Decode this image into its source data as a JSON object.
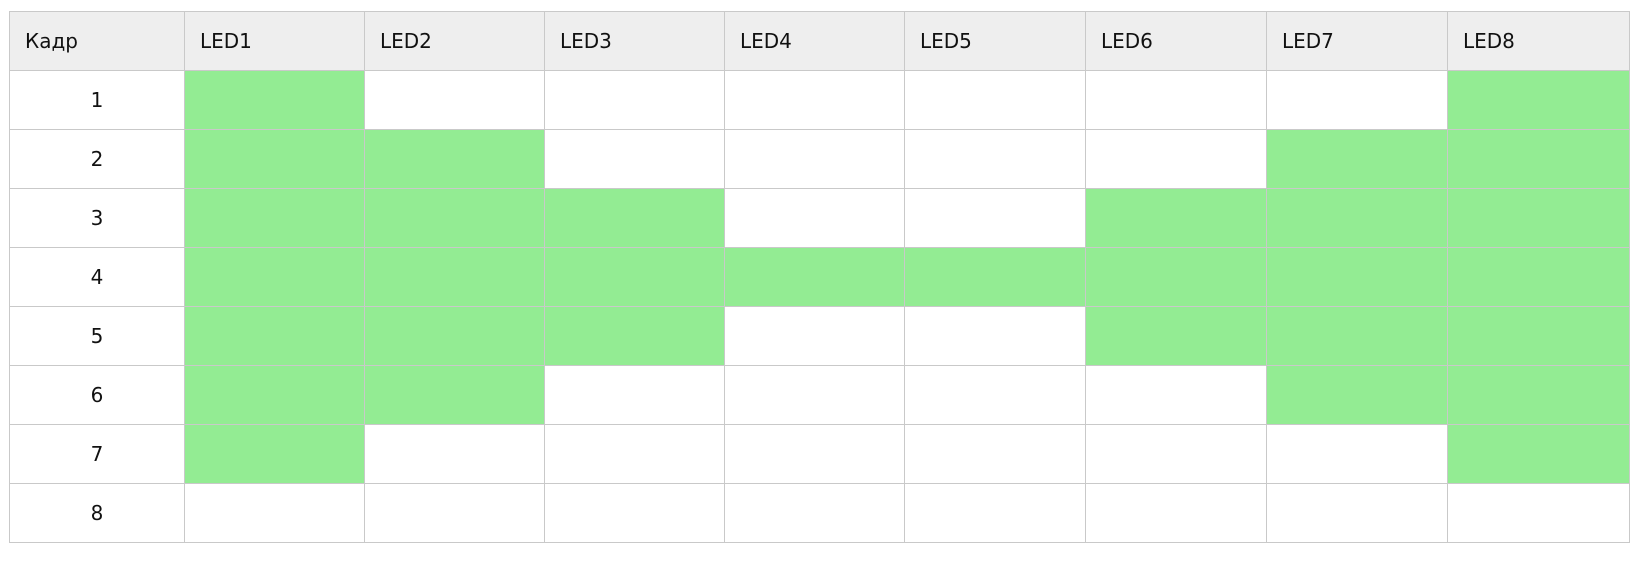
{
  "table": {
    "headers": [
      "Кадр",
      "LED1",
      "LED2",
      "LED3",
      "LED4",
      "LED5",
      "LED6",
      "LED7",
      "LED8"
    ],
    "rows": [
      {
        "frame": "1",
        "leds": [
          1,
          0,
          0,
          0,
          0,
          0,
          0,
          1
        ]
      },
      {
        "frame": "2",
        "leds": [
          1,
          1,
          0,
          0,
          0,
          0,
          1,
          1
        ]
      },
      {
        "frame": "3",
        "leds": [
          1,
          1,
          1,
          0,
          0,
          1,
          1,
          1
        ]
      },
      {
        "frame": "4",
        "leds": [
          1,
          1,
          1,
          1,
          1,
          1,
          1,
          1
        ]
      },
      {
        "frame": "5",
        "leds": [
          1,
          1,
          1,
          0,
          0,
          1,
          1,
          1
        ]
      },
      {
        "frame": "6",
        "leds": [
          1,
          1,
          0,
          0,
          0,
          0,
          1,
          1
        ]
      },
      {
        "frame": "7",
        "leds": [
          1,
          0,
          0,
          0,
          0,
          0,
          0,
          1
        ]
      },
      {
        "frame": "8",
        "leds": [
          0,
          0,
          0,
          0,
          0,
          0,
          0,
          0
        ]
      }
    ]
  },
  "colors": {
    "led_on": "#93ec93",
    "led_off": "#ffffff",
    "header_bg": "#eeeeee",
    "border": "#c9c9c9"
  }
}
